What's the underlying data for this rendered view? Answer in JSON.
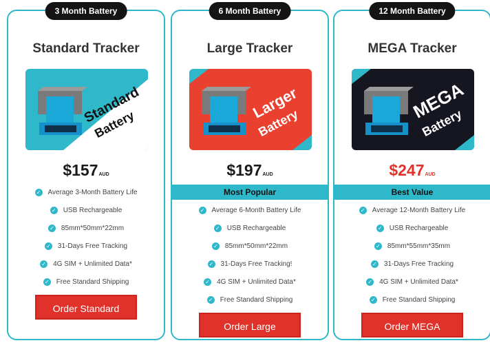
{
  "cards": [
    {
      "badge": "3 Month Battery",
      "title": "Standard Tracker",
      "image_text_1": "Standard",
      "image_text_2": "Battery",
      "image_colors": {
        "bg": "#2fb8c9",
        "stripe": "#ffffff",
        "text": "#111111"
      },
      "price": "$157",
      "currency": "AUD",
      "price_color": "#1a1a1a",
      "band": "",
      "features": [
        "Average 3-Month Battery Life",
        "USB Rechargeable",
        "85mm*50mm*22mm",
        "31-Days Free Tracking",
        "4G SIM + Unlimited Data*",
        "Free Standard Shipping"
      ],
      "button": "Order Standard"
    },
    {
      "badge": "6 Month Battery",
      "title": "Large Tracker",
      "image_text_1": "Larger",
      "image_text_2": "Battery",
      "image_colors": {
        "bg": "#e9402f",
        "stripe": "#2fb8c9",
        "text": "#ffffff"
      },
      "price": "$197",
      "currency": "AUD",
      "price_color": "#1a1a1a",
      "band": "Most Popular",
      "features": [
        "Average 6-Month Battery Life",
        "USB Rechargeable",
        "85mm*50mm*22mm",
        "31-Days Free Tracking!",
        "4G SIM + Unlimited Data*",
        "Free Standard Shipping"
      ],
      "button": "Order Large"
    },
    {
      "badge": "12 Month Battery",
      "title": "MEGA Tracker",
      "image_text_1": "MEGA",
      "image_text_2": "Battery",
      "image_colors": {
        "bg": "#161620",
        "stripe": "#2fb8c9",
        "text": "#ffffff"
      },
      "price": "$247",
      "currency": "AUD",
      "price_color": "#e0322a",
      "band": "Best Value",
      "features": [
        "Average 12-Month Battery Life",
        "USB Rechargeable",
        "85mm*55mm*35mm",
        "31-Days Free Tracking",
        "4G SIM + Unlimited Data*",
        "Free Standard Shipping"
      ],
      "button": "Order MEGA"
    }
  ],
  "colors": {
    "accent": "#2fb8c9",
    "button": "#e0322a",
    "pill": "#141414"
  }
}
